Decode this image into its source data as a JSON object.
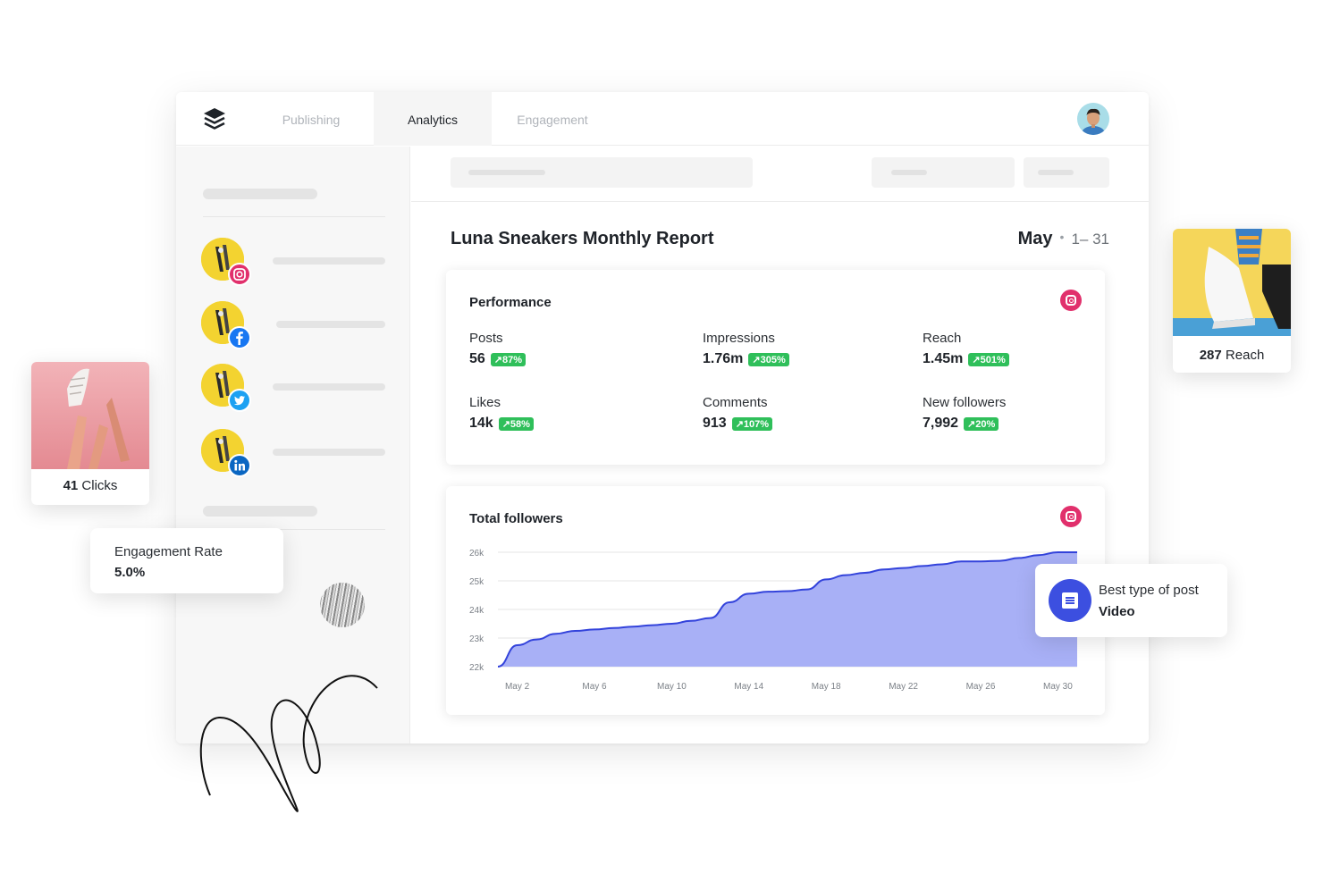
{
  "nav": {
    "tabs": [
      {
        "label": "Publishing"
      },
      {
        "label": "Analytics"
      },
      {
        "label": "Engagement"
      }
    ]
  },
  "report": {
    "title": "Luna Sneakers Monthly Report",
    "month": "May",
    "range": "1– 31"
  },
  "performance": {
    "title": "Performance",
    "metrics": [
      {
        "label": "Posts",
        "value": "56",
        "delta": "↗87%"
      },
      {
        "label": "Impressions",
        "value": "1.76m",
        "delta": "↗305%"
      },
      {
        "label": "Reach",
        "value": "1.45m",
        "delta": "↗501%"
      },
      {
        "label": "Likes",
        "value": "14k",
        "delta": "↗58%"
      },
      {
        "label": "Comments",
        "value": "913",
        "delta": "↗107%"
      },
      {
        "label": "New followers",
        "value": "7,992",
        "delta": "↗20%"
      }
    ]
  },
  "followers_card": {
    "title": "Total followers"
  },
  "floating": {
    "clicks": {
      "value": "41",
      "label": "Clicks"
    },
    "reach": {
      "value": "287",
      "label": "Reach"
    },
    "engagement": {
      "label": "Engagement Rate",
      "value": "5.0%"
    },
    "best_post": {
      "label": "Best type of post",
      "value": "Video"
    }
  },
  "colors": {
    "accent": "#3c4fe0",
    "area_fill": "#a3acf5",
    "area_line": "#3343db",
    "delta_green": "#2fbf5a",
    "instagram": "#e1306c"
  },
  "chart_data": {
    "type": "area",
    "title": "Total followers",
    "x": [
      "May 1",
      "May 2",
      "May 3",
      "May 4",
      "May 5",
      "May 6",
      "May 7",
      "May 8",
      "May 9",
      "May 10",
      "May 11",
      "May 12",
      "May 13",
      "May 14",
      "May 15",
      "May 16",
      "May 17",
      "May 18",
      "May 19",
      "May 20",
      "May 21",
      "May 22",
      "May 23",
      "May 24",
      "May 25",
      "May 26",
      "May 27",
      "May 28",
      "May 29",
      "May 30",
      "May 31"
    ],
    "tick_labels": [
      "May 2",
      "May 6",
      "May 10",
      "May 14",
      "May 18",
      "May 22",
      "May 26",
      "May 30"
    ],
    "y_ticks": [
      "26k",
      "25k",
      "24k",
      "23k",
      "22k"
    ],
    "ylim": [
      22000,
      26000
    ],
    "series": [
      {
        "values": [
          22000,
          22750,
          22950,
          23150,
          23250,
          23300,
          23350,
          23400,
          23450,
          23500,
          23600,
          23700,
          24250,
          24550,
          24620,
          24640,
          24700,
          25050,
          25200,
          25280,
          25400,
          25450,
          25520,
          25580,
          25680,
          25680,
          25700,
          25800,
          25900,
          26000,
          26000
        ]
      }
    ],
    "grid": true,
    "legend": "none"
  }
}
